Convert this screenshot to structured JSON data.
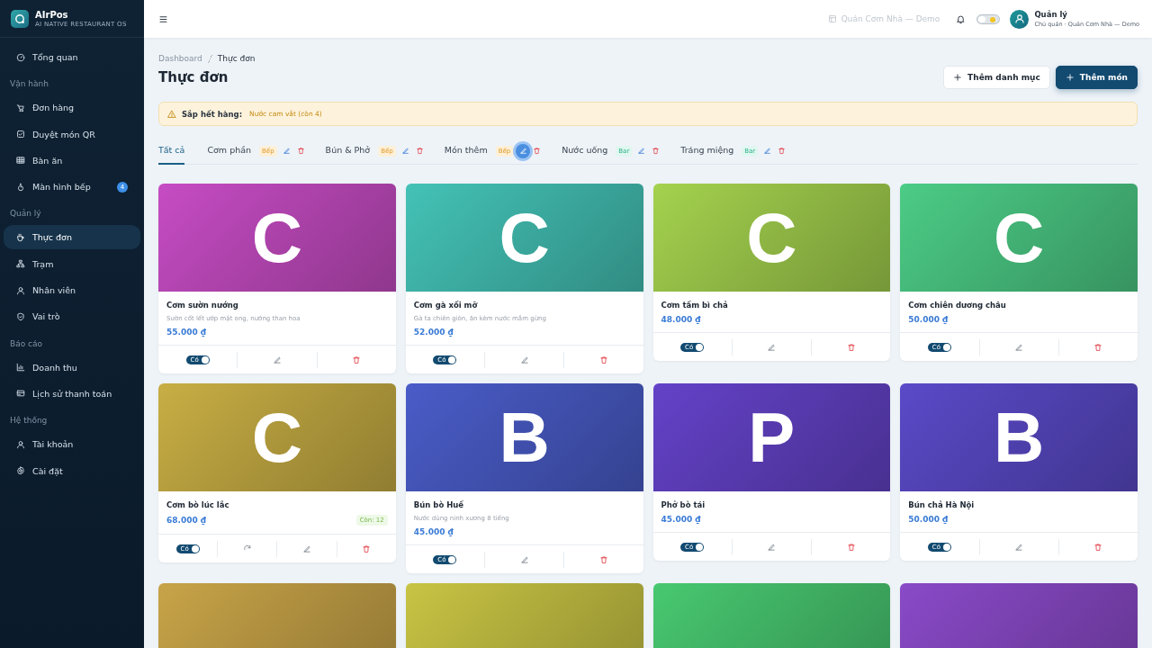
{
  "brand": {
    "name": "AIrPos",
    "tagline": "AI NATIVE RESTAURANT OS"
  },
  "sidebar": {
    "sections": [
      {
        "items": [
          {
            "label": "Tổng quan",
            "selected": false
          }
        ]
      },
      {
        "title": "Vận hành",
        "items": [
          {
            "label": "Đơn hàng",
            "selected": false
          },
          {
            "label": "Duyệt món QR",
            "selected": false
          },
          {
            "label": "Bàn ăn",
            "selected": false
          },
          {
            "label": "Màn hình bếp",
            "selected": false,
            "badge": "4"
          }
        ]
      },
      {
        "title": "Quản lý",
        "items": [
          {
            "label": "Thực đơn",
            "selected": true
          },
          {
            "label": "Trạm",
            "selected": false
          },
          {
            "label": "Nhân viên",
            "selected": false
          },
          {
            "label": "Vai trò",
            "selected": false
          }
        ]
      },
      {
        "title": "Báo cáo",
        "items": [
          {
            "label": "Doanh thu",
            "selected": false
          },
          {
            "label": "Lịch sử thanh toán",
            "selected": false
          }
        ]
      },
      {
        "title": "Hệ thống",
        "items": [
          {
            "label": "Tài khoản",
            "selected": false
          },
          {
            "label": "Cài đặt",
            "selected": false
          }
        ]
      }
    ]
  },
  "topbar": {
    "store": "Quán Cơm Nhà — Demo",
    "theme_dark": false,
    "user": {
      "name": "Quản lý",
      "role": "Chủ quán · Quán Cơm Nhà — Demo"
    }
  },
  "breadcrumb": [
    "Dashboard",
    "Thực đơn"
  ],
  "page_title": "Thực đơn",
  "actions": [
    {
      "label": "Thêm danh mục",
      "kind": "secondary"
    },
    {
      "label": "Thêm món",
      "kind": "primary"
    }
  ],
  "alert": {
    "title": "Sắp hết hàng:",
    "text": "Nước cam vắt (còn 4)"
  },
  "tabs": [
    {
      "label": "Tất cả",
      "selected": true,
      "kind": "all"
    },
    {
      "label": "Cơm phần",
      "selected": false,
      "station": "Bếp",
      "kind": "kitchen",
      "highlighted": false
    },
    {
      "label": "Bún & Phở",
      "selected": false,
      "station": "Bếp",
      "kind": "kitchen",
      "highlighted": false
    },
    {
      "label": "Món thêm",
      "selected": false,
      "station": "Bếp",
      "kind": "kitchen",
      "highlighted": true
    },
    {
      "label": "Nước uống",
      "selected": false,
      "station": "Bar",
      "kind": "bar",
      "highlighted": false
    },
    {
      "label": "Tráng miệng",
      "selected": false,
      "station": "Bar",
      "kind": "bar",
      "highlighted": false
    }
  ],
  "items": [
    {
      "letter": "C",
      "color": "#c64cc4",
      "name": "Cơm sườn nướng",
      "description": "Sườn cốt lết ướp mật ong, nướng than hoa",
      "price": "55.000 ₫",
      "available": true,
      "toggle_label": "Có"
    },
    {
      "letter": "C",
      "color": "#44c2b6",
      "name": "Cơm gà xối mỡ",
      "description": "Gà ta chiên giòn, ăn kèm nước mắm gừng",
      "price": "52.000 ₫",
      "available": true,
      "toggle_label": "Có"
    },
    {
      "letter": "C",
      "color": "#a4d24e",
      "name": "Cơm tấm bì chả",
      "price": "48.000 ₫",
      "available": true,
      "toggle_label": "Có"
    },
    {
      "letter": "C",
      "color": "#4ccc86",
      "name": "Cơm chiên dương châu",
      "price": "50.000 ₫",
      "available": true,
      "toggle_label": "Có"
    },
    {
      "letter": "C",
      "color": "#c8ae44",
      "name": "Cơm bò lúc lắc",
      "price": "68.000 ₫",
      "stock": "Còn: 12",
      "available": true,
      "toggle_label": "Có"
    },
    {
      "letter": "B",
      "color": "#4a5cc8",
      "name": "Bún bò Huế",
      "description": "Nước dùng ninh xương 8 tiếng",
      "price": "45.000 ₫",
      "available": true,
      "toggle_label": "Có"
    },
    {
      "letter": "P",
      "color": "#6442c8",
      "name": "Phở bò tái",
      "price": "45.000 ₫",
      "available": true,
      "toggle_label": "Có"
    },
    {
      "letter": "B",
      "color": "#5a4ac8",
      "name": "Bún chả Hà Nội",
      "price": "50.000 ₫",
      "available": true,
      "toggle_label": "Có"
    },
    {
      "color": "#c8a448"
    },
    {
      "color": "#c8c444"
    },
    {
      "color": "#48c870"
    },
    {
      "color": "#8a4ac8"
    }
  ]
}
